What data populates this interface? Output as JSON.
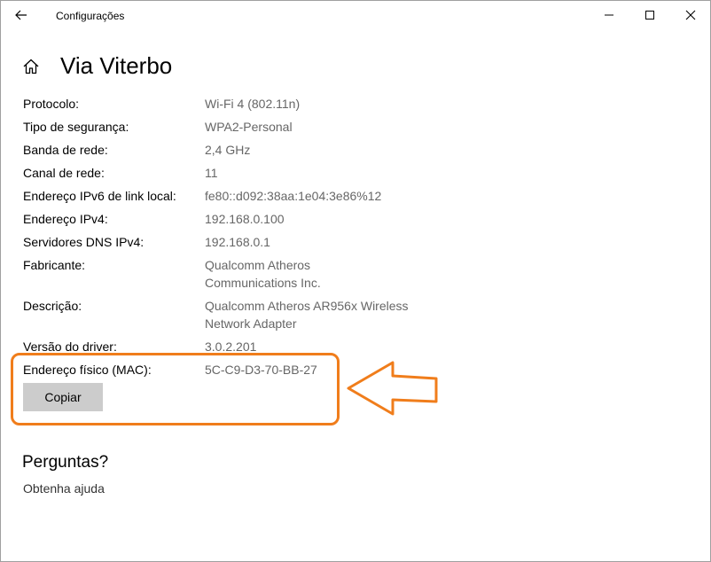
{
  "window": {
    "title": "Configurações"
  },
  "page": {
    "title": "Via Viterbo"
  },
  "properties": [
    {
      "label": "Protocolo:",
      "value": "Wi-Fi 4 (802.11n)"
    },
    {
      "label": "Tipo de segurança:",
      "value": "WPA2-Personal"
    },
    {
      "label": "Banda de rede:",
      "value": "2,4 GHz"
    },
    {
      "label": "Canal de rede:",
      "value": "11"
    },
    {
      "label": "Endereço IPv6 de link local:",
      "value": "fe80::d092:38aa:1e04:3e86%12"
    },
    {
      "label": "Endereço IPv4:",
      "value": "192.168.0.100"
    },
    {
      "label": "Servidores DNS IPv4:",
      "value": "192.168.0.1"
    },
    {
      "label": "Fabricante:",
      "value": "Qualcomm Atheros\nCommunications Inc."
    },
    {
      "label": "Descrição:",
      "value": "Qualcomm Atheros AR956x Wireless\nNetwork Adapter"
    },
    {
      "label": "Versão do driver:",
      "value": "3.0.2.201"
    },
    {
      "label": "Endereço físico (MAC):",
      "value": "5C-C9-D3-70-BB-27"
    }
  ],
  "copy_button": {
    "label": "Copiar"
  },
  "help": {
    "title": "Perguntas?",
    "link": "Obtenha ajuda"
  },
  "colors": {
    "highlight": "#f07d1b",
    "value_text": "#666666",
    "button_bg": "#cccccc"
  },
  "icons": [
    "back-arrow-icon",
    "minimize-icon",
    "maximize-icon",
    "close-icon",
    "home-icon",
    "pointer-arrow-icon"
  ]
}
